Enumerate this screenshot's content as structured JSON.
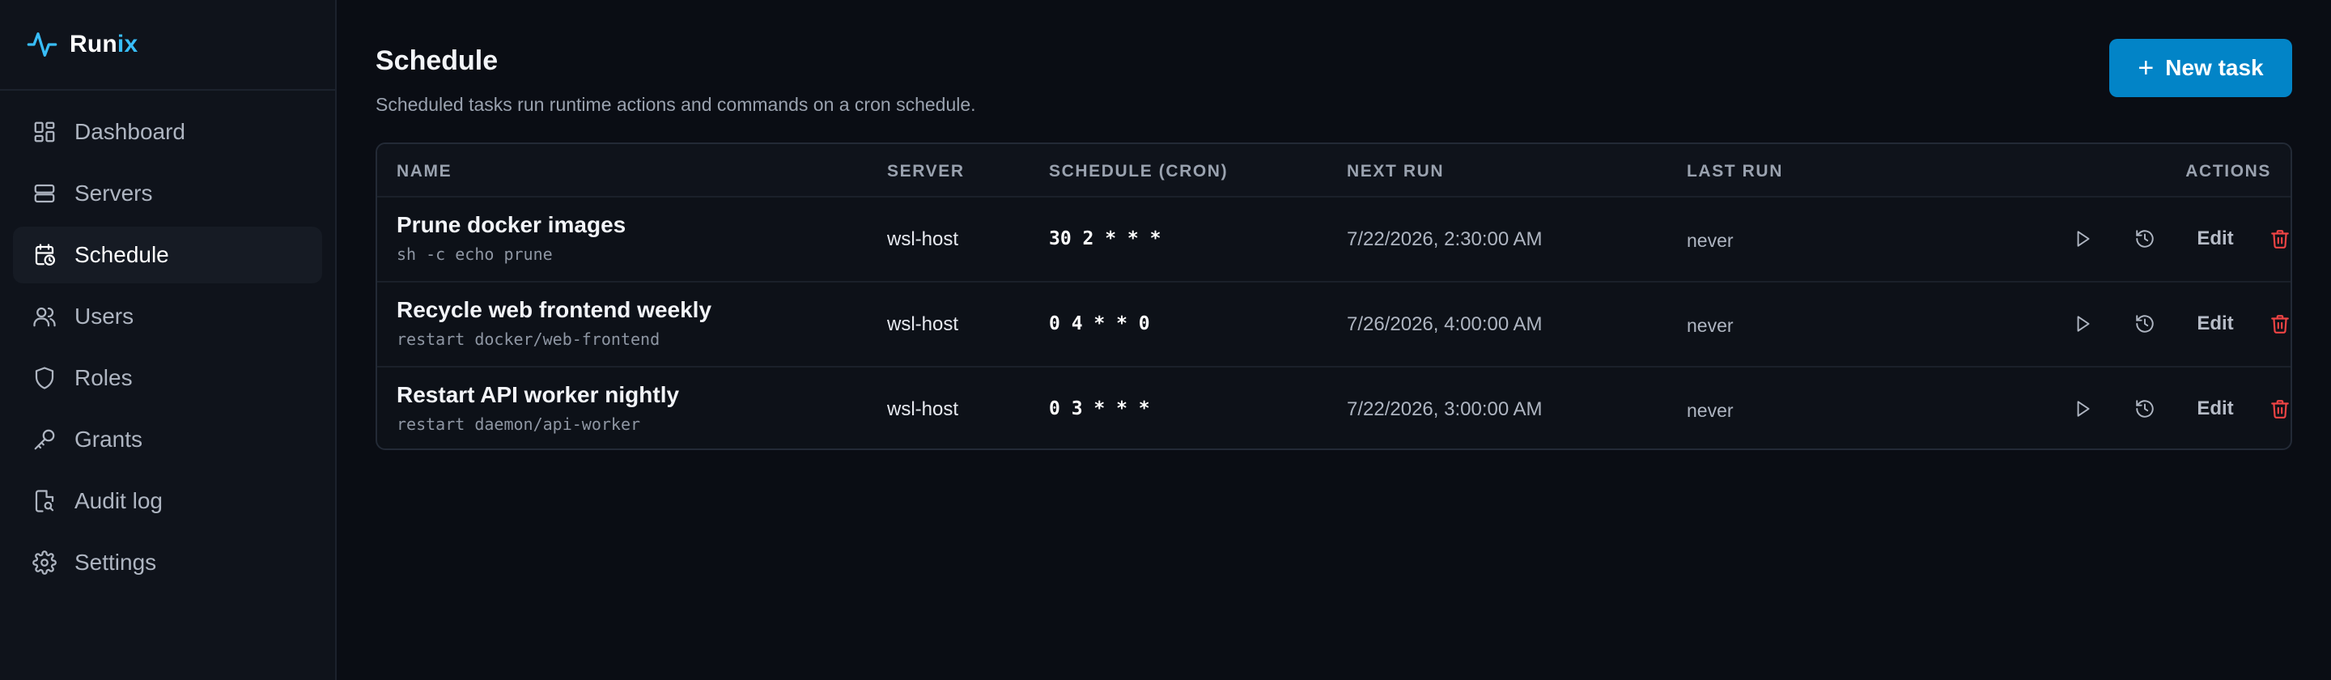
{
  "app": {
    "name_part1": "Run",
    "name_part2": "ix",
    "accent": "#38bdf8"
  },
  "sidebar": {
    "items": [
      {
        "label": "Dashboard",
        "icon": "dashboard-icon"
      },
      {
        "label": "Servers",
        "icon": "servers-icon"
      },
      {
        "label": "Schedule",
        "icon": "calendar-clock-icon",
        "active": true
      },
      {
        "label": "Users",
        "icon": "users-icon"
      },
      {
        "label": "Roles",
        "icon": "shield-icon"
      },
      {
        "label": "Grants",
        "icon": "key-icon"
      },
      {
        "label": "Audit log",
        "icon": "file-search-icon"
      },
      {
        "label": "Settings",
        "icon": "gear-icon"
      }
    ]
  },
  "page": {
    "title": "Schedule",
    "subtitle": "Scheduled tasks run runtime actions and commands on a cron schedule.",
    "new_button": {
      "plus": "+",
      "label": "New task",
      "color": "#0284c7"
    }
  },
  "table": {
    "headers": {
      "name": "NAME",
      "server": "SERVER",
      "schedule": "SCHEDULE (CRON)",
      "next_run": "NEXT RUN",
      "last_run": "LAST RUN",
      "actions": "ACTIONS"
    },
    "rows": [
      {
        "name": "Prune docker images",
        "command": "sh -c echo prune",
        "server": "wsl-host",
        "cron": "30 2 * * *",
        "next_run": "7/22/2026, 2:30:00 AM",
        "last_run": "never",
        "edit": "Edit"
      },
      {
        "name": "Recycle web frontend weekly",
        "command": "restart docker/web-frontend",
        "server": "wsl-host",
        "cron": "0 4 * * 0",
        "next_run": "7/26/2026, 4:00:00 AM",
        "last_run": "never",
        "edit": "Edit"
      },
      {
        "name": "Restart API worker nightly",
        "command": "restart daemon/api-worker",
        "server": "wsl-host",
        "cron": "0 3 * * *",
        "next_run": "7/22/2026, 3:00:00 AM",
        "last_run": "never",
        "edit": "Edit"
      }
    ],
    "delete_color": "#ef4444"
  }
}
